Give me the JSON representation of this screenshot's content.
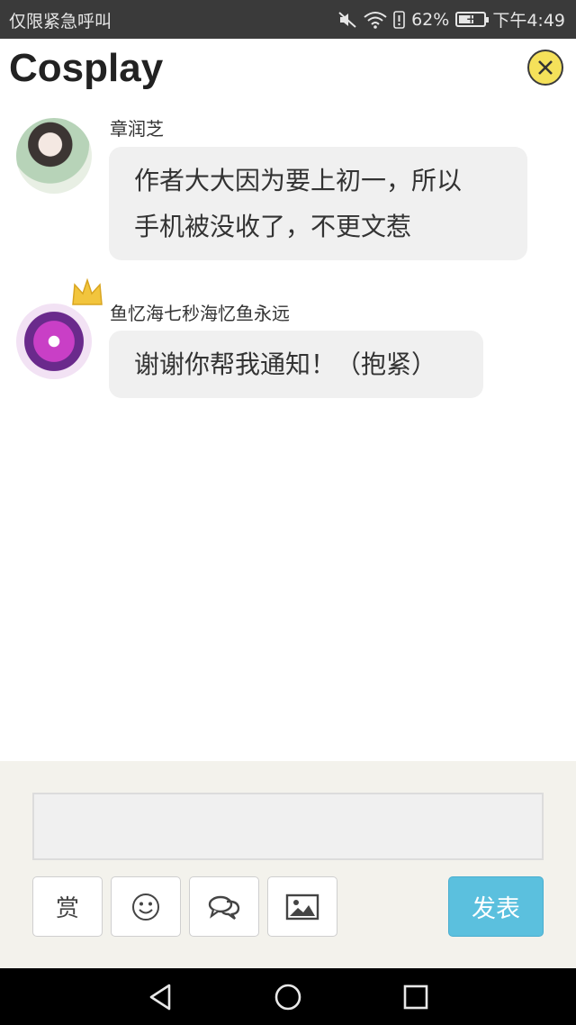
{
  "status_bar": {
    "carrier": "仅限紧急呼叫",
    "battery_percent": "62%",
    "battery_level": 0.62,
    "time": "下午4:49",
    "icons": [
      "mute-icon",
      "wifi-icon",
      "alert-icon",
      "battery-icon"
    ]
  },
  "header": {
    "title": "Cosplay",
    "close_icon": "close-icon"
  },
  "messages": [
    {
      "sender": "章润芝",
      "lines": [
        "作者大大因为要上初一，所以",
        "手机被没收了，不更文惹"
      ]
    },
    {
      "sender": "鱼忆海七秒海忆鱼永远",
      "lines": [
        "谢谢你帮我通知！（抱紧）"
      ]
    }
  ],
  "composer": {
    "input_value": "",
    "reward_label": "赏",
    "send_label": "发表",
    "tools": [
      "reward-button",
      "emoji-icon",
      "chat-bubbles-icon",
      "image-icon"
    ],
    "send_color": "#5bc0de"
  },
  "nav_bar": {
    "icons": [
      "back-icon",
      "home-icon",
      "recents-icon"
    ]
  }
}
